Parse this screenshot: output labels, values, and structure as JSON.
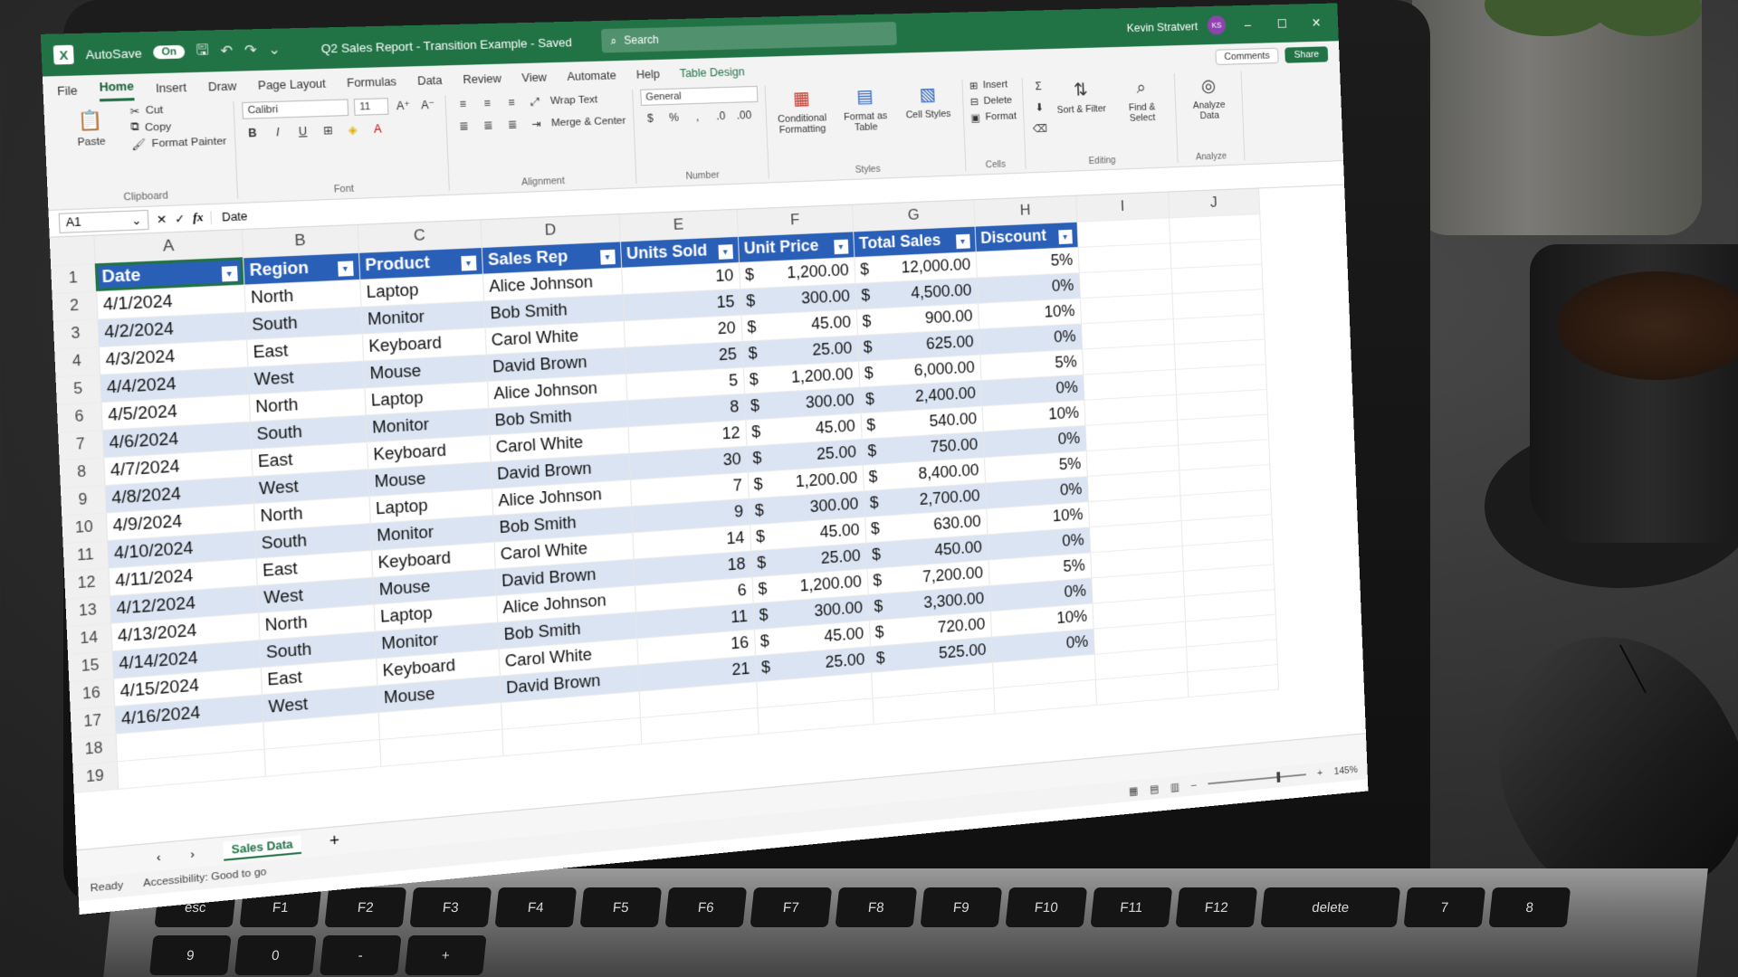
{
  "titlebar": {
    "autosave": "AutoSave",
    "toggle": "On",
    "doc_title": "Q2 Sales Report - Transition Example - Saved",
    "search_placeholder": "Search",
    "user": "Kevin Stratvert",
    "initials": "KS"
  },
  "tabs": [
    "File",
    "Home",
    "Insert",
    "Draw",
    "Page Layout",
    "Formulas",
    "Data",
    "Review",
    "View",
    "Automate",
    "Help",
    "Table Design"
  ],
  "tab_buttons": {
    "comments": "Comments",
    "share": "Share"
  },
  "ribbon": {
    "clipboard": {
      "paste": "Paste",
      "cut": "Cut",
      "copy": "Copy",
      "format_painter": "Format Painter",
      "label": "Clipboard"
    },
    "font": {
      "name": "Calibri",
      "size": "11",
      "label": "Font"
    },
    "alignment": {
      "wrap": "Wrap Text",
      "merge": "Merge & Center",
      "label": "Alignment"
    },
    "number": {
      "format": "General",
      "label": "Number"
    },
    "styles": {
      "conditional": "Conditional Formatting",
      "format_table": "Format as Table",
      "cell_styles": "Cell Styles",
      "label": "Styles"
    },
    "cells": {
      "insert": "Insert",
      "delete": "Delete",
      "format": "Format",
      "label": "Cells"
    },
    "editing": {
      "sort": "Sort & Filter",
      "find": "Find & Select",
      "label": "Editing"
    },
    "analyze": {
      "analyze_data": "Analyze Data",
      "label": "Analyze"
    }
  },
  "formula_bar": {
    "namebox": "A1",
    "fx": "fx",
    "value": "Date"
  },
  "columns": [
    "A",
    "B",
    "C",
    "D",
    "E",
    "F",
    "G",
    "H",
    "I",
    "J"
  ],
  "headers": [
    "Date",
    "Region",
    "Product",
    "Sales Rep",
    "Units Sold",
    "Unit Price",
    "Total Sales",
    "Discount"
  ],
  "rows": [
    [
      "4/1/2024",
      "North",
      "Laptop",
      "Alice Johnson",
      "10",
      "1,200.00",
      "12,000.00",
      "5%"
    ],
    [
      "4/2/2024",
      "South",
      "Monitor",
      "Bob Smith",
      "15",
      "300.00",
      "4,500.00",
      "0%"
    ],
    [
      "4/3/2024",
      "East",
      "Keyboard",
      "Carol White",
      "20",
      "45.00",
      "900.00",
      "10%"
    ],
    [
      "4/4/2024",
      "West",
      "Mouse",
      "David Brown",
      "25",
      "25.00",
      "625.00",
      "0%"
    ],
    [
      "4/5/2024",
      "North",
      "Laptop",
      "Alice Johnson",
      "5",
      "1,200.00",
      "6,000.00",
      "5%"
    ],
    [
      "4/6/2024",
      "South",
      "Monitor",
      "Bob Smith",
      "8",
      "300.00",
      "2,400.00",
      "0%"
    ],
    [
      "4/7/2024",
      "East",
      "Keyboard",
      "Carol White",
      "12",
      "45.00",
      "540.00",
      "10%"
    ],
    [
      "4/8/2024",
      "West",
      "Mouse",
      "David Brown",
      "30",
      "25.00",
      "750.00",
      "0%"
    ],
    [
      "4/9/2024",
      "North",
      "Laptop",
      "Alice Johnson",
      "7",
      "1,200.00",
      "8,400.00",
      "5%"
    ],
    [
      "4/10/2024",
      "South",
      "Monitor",
      "Bob Smith",
      "9",
      "300.00",
      "2,700.00",
      "0%"
    ],
    [
      "4/11/2024",
      "East",
      "Keyboard",
      "Carol White",
      "14",
      "45.00",
      "630.00",
      "10%"
    ],
    [
      "4/12/2024",
      "West",
      "Mouse",
      "David Brown",
      "18",
      "25.00",
      "450.00",
      "0%"
    ],
    [
      "4/13/2024",
      "North",
      "Laptop",
      "Alice Johnson",
      "6",
      "1,200.00",
      "7,200.00",
      "5%"
    ],
    [
      "4/14/2024",
      "South",
      "Monitor",
      "Bob Smith",
      "11",
      "300.00",
      "3,300.00",
      "0%"
    ],
    [
      "4/15/2024",
      "East",
      "Keyboard",
      "Carol White",
      "16",
      "45.00",
      "720.00",
      "10%"
    ],
    [
      "4/16/2024",
      "West",
      "Mouse",
      "David Brown",
      "21",
      "25.00",
      "525.00",
      "0%"
    ]
  ],
  "currency_symbol": "$",
  "sheet_tab": "Sales Data",
  "add_sheet": "+",
  "status": {
    "ready": "Ready",
    "accessibility": "Accessibility: Good to go",
    "zoom": "145%"
  },
  "keyboard": [
    "esc",
    "F1",
    "F2",
    "F3",
    "F4",
    "F5",
    "F6",
    "F7",
    "F8",
    "F9",
    "F10",
    "F11",
    "F12",
    "delete",
    "7",
    "8",
    "9",
    "0",
    "-",
    "+"
  ],
  "colors": {
    "excel_green": "#217346",
    "table_header": "#2a5fb8",
    "band": "#dbe4f3"
  }
}
